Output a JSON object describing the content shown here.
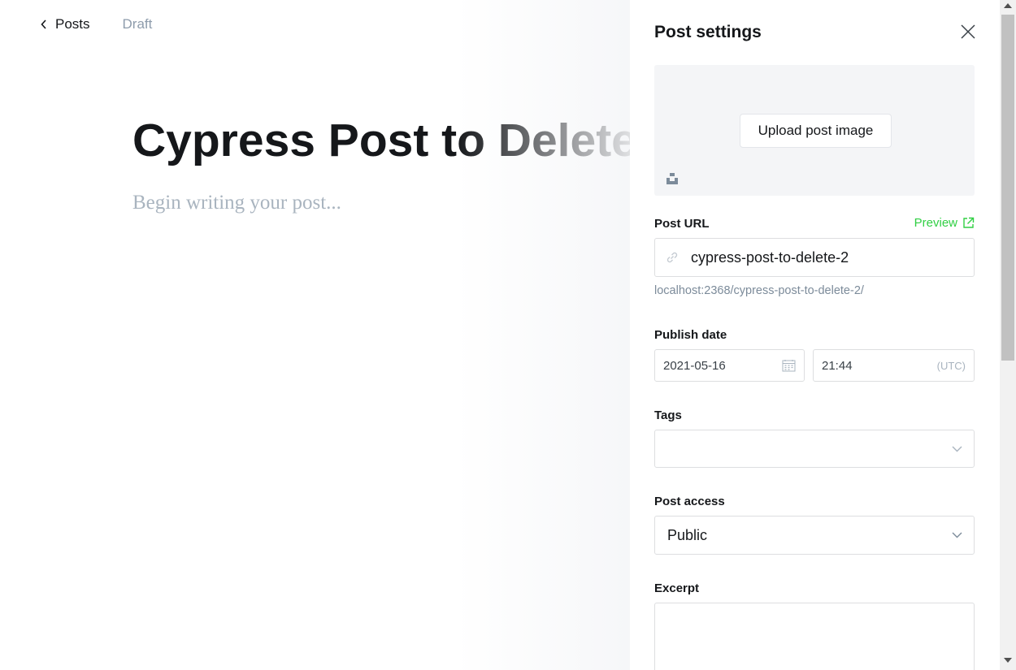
{
  "header": {
    "back_label": "Posts",
    "status": "Draft"
  },
  "editor": {
    "title": "Cypress Post to Delete",
    "body_placeholder": "Begin writing your post..."
  },
  "settings": {
    "title": "Post settings",
    "upload_image_label": "Upload post image",
    "post_url_label": "Post URL",
    "preview_label": "Preview",
    "url_value": "cypress-post-to-delete-2",
    "url_hint": "localhost:2368/cypress-post-to-delete-2/",
    "publish_date_label": "Publish date",
    "date_value": "2021-05-16",
    "time_value": "21:44",
    "timezone": "(UTC)",
    "tags_label": "Tags",
    "post_access_label": "Post access",
    "post_access_value": "Public",
    "excerpt_label": "Excerpt"
  },
  "colors": {
    "accent_green": "#30cf43",
    "text": "#15171a",
    "muted": "#8e9cac"
  },
  "icons": [
    "chevron-left-icon",
    "close-icon",
    "unsplash-icon",
    "external-link-icon",
    "link-icon",
    "calendar-icon",
    "chevron-down-icon"
  ]
}
